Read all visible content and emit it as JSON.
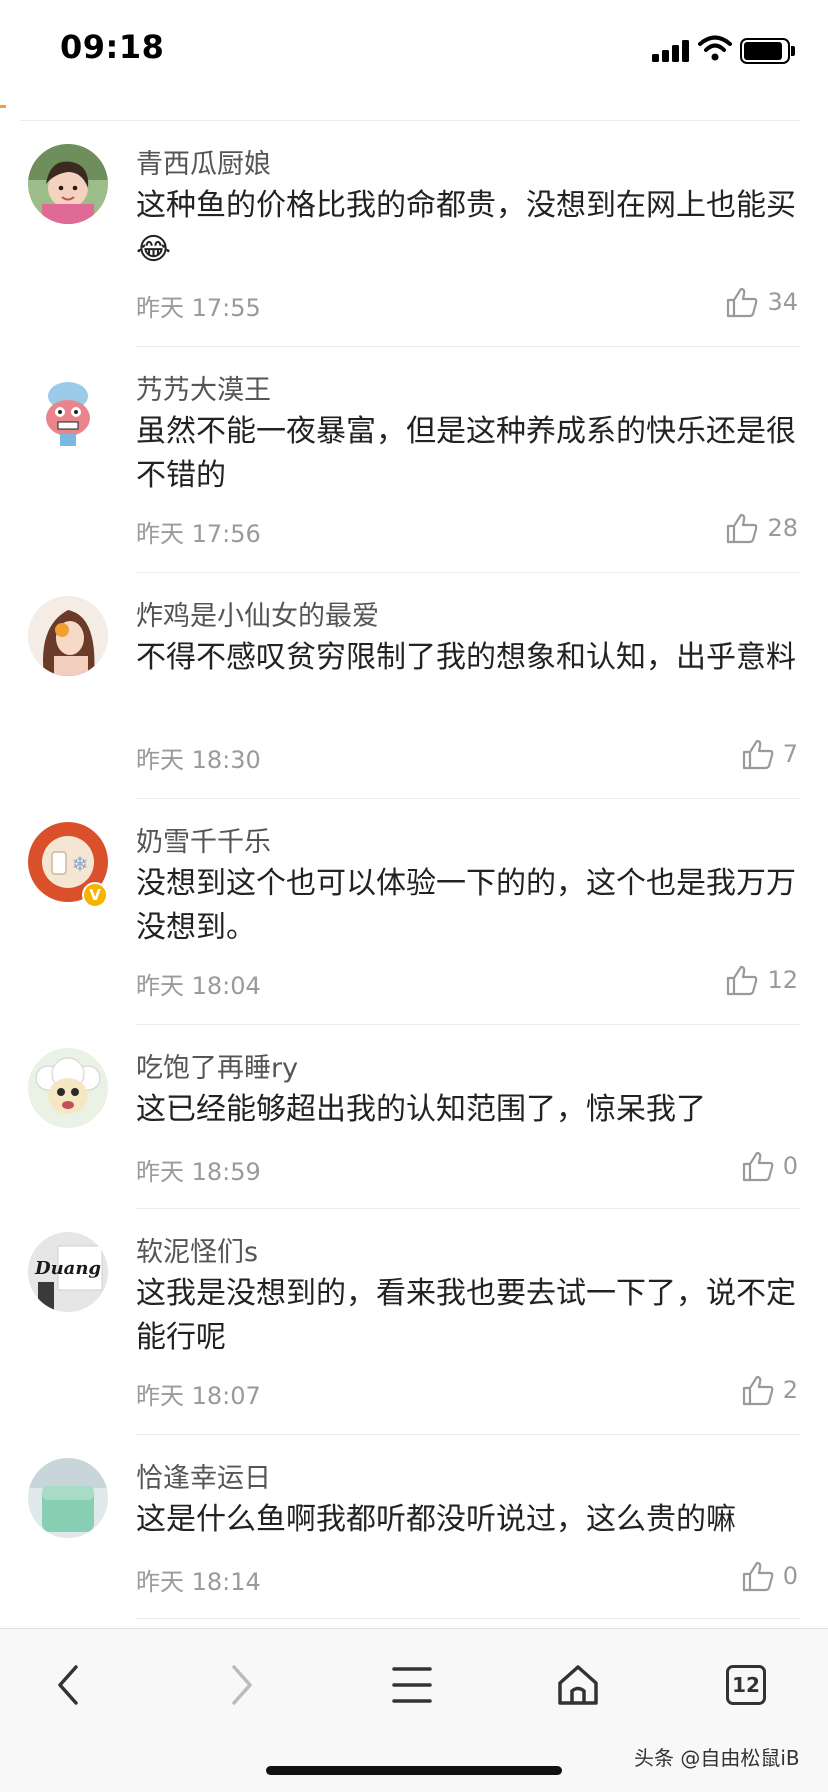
{
  "status_bar": {
    "time": "09:18"
  },
  "comments": [
    {
      "username": "青西瓜厨娘",
      "text": "这种鱼的价格比我的命都贵，没想到在网上也能买",
      "emoji": "😂",
      "time": "昨天 17:55",
      "likes": "34"
    },
    {
      "username": "艿艿大漠王",
      "text": "虽然不能一夜暴富，但是这种养成系的快乐还是很不错的",
      "time": "昨天 17:56",
      "likes": "28"
    },
    {
      "username": "炸鸡是小仙女的最爱",
      "text": "不得不感叹贫穷限制了我的想象和认知，出乎意料",
      "time": "昨天 18:30",
      "likes": "7"
    },
    {
      "username": "奶雪千千乐",
      "text": "没想到这个也可以体验一下的的，这个也是我万万没想到。",
      "time": "昨天 18:04",
      "likes": "12",
      "verified_mark": "V"
    },
    {
      "username": "吃饱了再睡ry",
      "text": "这已经能够超出我的认知范围了，惊呆我了",
      "time": "昨天 18:59",
      "likes": "0"
    },
    {
      "username": "软泥怪们s",
      "text": "这我是没想到的，看来我也要去试一下了，说不定能行呢",
      "time": "昨天 18:07",
      "likes": "2",
      "avatar_text": "Duang"
    },
    {
      "username": "恰逢幸运日",
      "text": "这是什么鱼啊我都听都没听说过，这么贵的嘛",
      "time": "昨天 18:14",
      "likes": "0"
    }
  ],
  "bottom_nav": {
    "items": [
      {
        "name": "back",
        "icon": "chevron-left-icon"
      },
      {
        "name": "forward",
        "icon": "chevron-right-icon"
      },
      {
        "name": "menu",
        "icon": "menu-icon"
      },
      {
        "name": "home",
        "icon": "home-icon"
      },
      {
        "name": "tabs",
        "icon": "tabs-icon"
      }
    ],
    "tabs_count": "12"
  },
  "watermark": "头条 @自由松鼠iB",
  "colors": {
    "text": "#222222",
    "meta": "#9a9a9a",
    "username": "#555555",
    "divider": "#ebebeb",
    "verified": "#f5b400"
  }
}
